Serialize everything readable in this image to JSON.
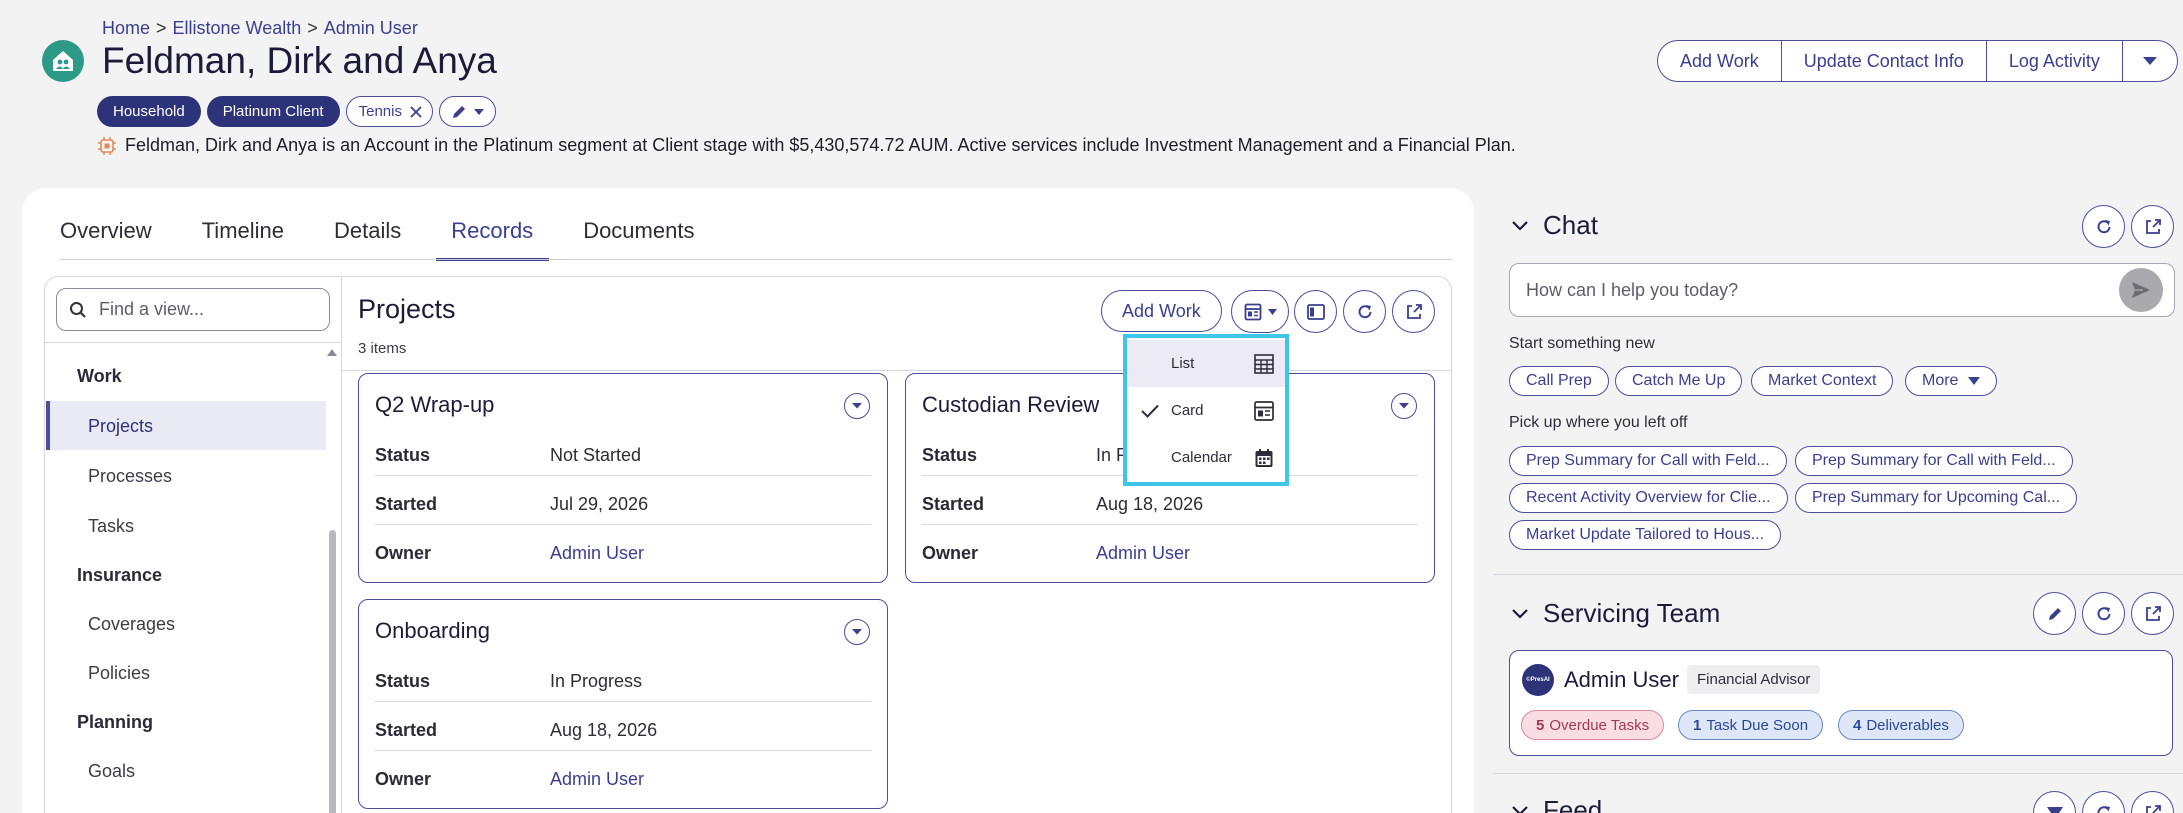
{
  "breadcrumb": [
    "Home",
    "Ellistone Wealth",
    "Admin User"
  ],
  "breadcrumb_sep": ">",
  "page_title": "Feldman, Dirk and Anya",
  "tags": {
    "household": "Household",
    "client_tier": "Platinum Client",
    "custom": "Tennis"
  },
  "ai_summary": "Feldman, Dirk and Anya is an Account in the Platinum segment at Client stage with $5,430,574.72 AUM. Active services include Investment Management and a Financial Plan.",
  "header_actions": [
    "Add Work",
    "Update Contact Info",
    "Log Activity"
  ],
  "tabs": [
    "Overview",
    "Timeline",
    "Details",
    "Records",
    "Documents"
  ],
  "active_tab": "Records",
  "sidebar": {
    "search_placeholder": "Find a view...",
    "groups": [
      {
        "label": "Work",
        "items": [
          "Projects",
          "Processes",
          "Tasks"
        ]
      },
      {
        "label": "Insurance",
        "items": [
          "Coverages",
          "Policies"
        ]
      },
      {
        "label": "Planning",
        "items": [
          "Goals"
        ]
      }
    ],
    "active_item": "Projects"
  },
  "records": {
    "title": "Projects",
    "count": "3 items",
    "add_button": "Add Work",
    "labels": {
      "status": "Status",
      "started": "Started",
      "owner": "Owner"
    },
    "cards": [
      {
        "title": "Q2 Wrap-up",
        "status": "Not Started",
        "started": "Jul 29, 2026",
        "owner": "Admin User"
      },
      {
        "title": "Custodian Review",
        "status": "In P",
        "started": "Aug 18, 2026",
        "owner": "Admin User"
      },
      {
        "title": "Onboarding",
        "status": "In Progress",
        "started": "Aug 18, 2026",
        "owner": "Admin User"
      }
    ]
  },
  "view_menu": {
    "items": [
      "List",
      "Card",
      "Calendar"
    ],
    "selected": "Card",
    "hovered": "List"
  },
  "chat": {
    "title": "Chat",
    "placeholder": "How can I help you today?",
    "start_heading": "Start something new",
    "start_prompts": [
      "Call Prep",
      "Catch Me Up",
      "Market Context",
      "More"
    ],
    "resume_heading": "Pick up where you left off",
    "recent": [
      "Prep Summary for Call with Feld...",
      "Prep Summary for Call with Feld...",
      "Recent Activity Overview for Clie...",
      "Prep Summary for Upcoming Cal...",
      "Market Update Tailored to Hous..."
    ]
  },
  "servicing_team": {
    "title": "Servicing Team",
    "member": {
      "name": "Admin User",
      "role": "Financial Advisor",
      "avatar_text": "©PresAI"
    },
    "badges": [
      {
        "count": "5",
        "label": "Overdue Tasks",
        "color": "#f8dde3"
      },
      {
        "count": "1",
        "label": "Task Due Soon",
        "color": "#dde7f8"
      },
      {
        "count": "4",
        "label": "Deliverables",
        "color": "#dde7f8"
      }
    ]
  },
  "feed": {
    "title": "Feed"
  },
  "colors": {
    "accent": "#3a3f8f",
    "brand_green": "#2c9a86",
    "highlight": "#40c4e8"
  }
}
